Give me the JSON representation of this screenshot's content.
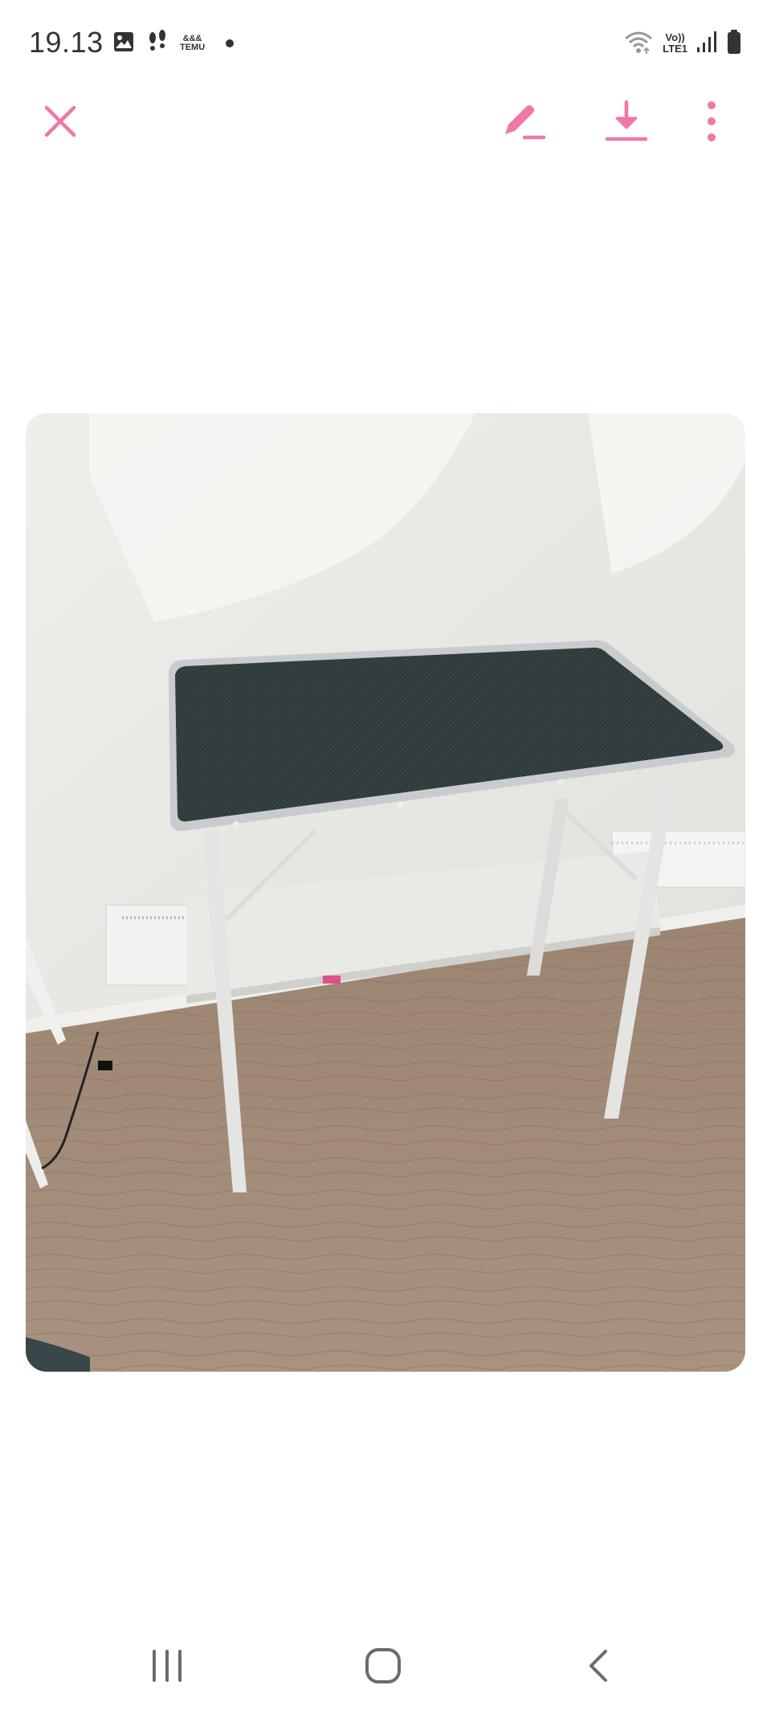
{
  "status_bar": {
    "time": "19.13",
    "temu_label": "TEMU",
    "temu_sub": "&&&",
    "volte_line1": "Vo))",
    "volte_line2": "LTE1"
  },
  "toolbar": {
    "close_icon": "close-icon",
    "edit_icon": "pencil-icon",
    "download_icon": "download-icon",
    "more_icon": "more-vertical-icon"
  },
  "image": {
    "subject": "table photo"
  },
  "nav": {
    "recent_icon": "recent-apps-icon",
    "home_icon": "home-icon",
    "back_icon": "back-icon"
  },
  "colors": {
    "accent": "#F078A6",
    "status_text": "#333333",
    "nav_icon": "#6b6b6b"
  }
}
